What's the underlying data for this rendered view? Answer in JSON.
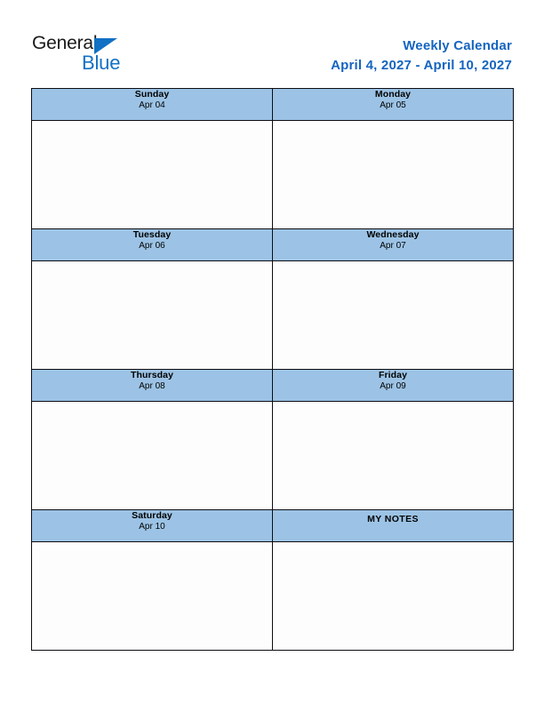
{
  "document": {
    "type": "weekly-calendar"
  },
  "logo": {
    "word_top": "General",
    "word_bottom": "Blue",
    "triangle_color": "#1271c4",
    "top_color": "#1a1a1a",
    "bottom_color": "#1271c4"
  },
  "header": {
    "title": "Weekly Calendar",
    "date_range": "April 4, 2027 - April 10, 2027",
    "title_color": "#1565c0"
  },
  "colors": {
    "header_cell_background": "#9cc3e5",
    "border": "#0d0d12",
    "body_cell_background": "#fdfdfd",
    "page_background": "#ffffff"
  },
  "notes": {
    "label": "MY NOTES",
    "content": ""
  },
  "rows": [
    {
      "left": {
        "day": "Sunday",
        "date": "Apr 04",
        "content": ""
      },
      "right": {
        "day": "Monday",
        "date": "Apr 05",
        "content": ""
      }
    },
    {
      "left": {
        "day": "Tuesday",
        "date": "Apr 06",
        "content": ""
      },
      "right": {
        "day": "Wednesday",
        "date": "Apr 07",
        "content": ""
      }
    },
    {
      "left": {
        "day": "Thursday",
        "date": "Apr 08",
        "content": ""
      },
      "right": {
        "day": "Friday",
        "date": "Apr 09",
        "content": ""
      }
    },
    {
      "left": {
        "day": "Saturday",
        "date": "Apr 10",
        "content": ""
      },
      "right": {
        "day": "MY NOTES",
        "date": "",
        "content": ""
      }
    }
  ]
}
